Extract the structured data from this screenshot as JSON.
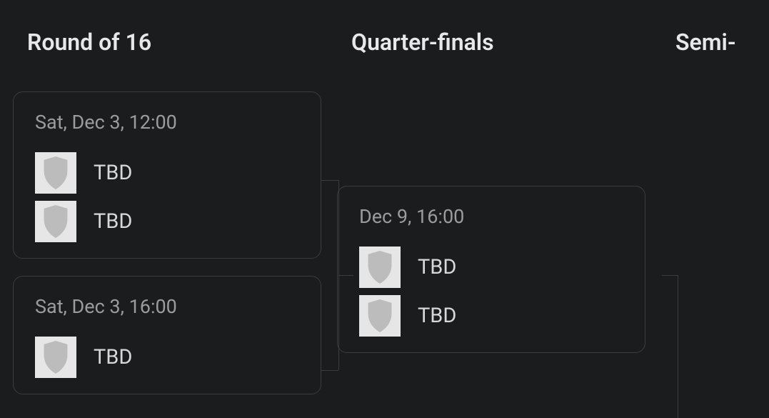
{
  "rounds": {
    "r16": {
      "title": "Round of 16"
    },
    "qf": {
      "title": "Quarter-finals"
    },
    "sf": {
      "title": "Semi-"
    }
  },
  "matches": {
    "r16_1": {
      "date": "Sat, Dec 3, 12:00",
      "team1": "TBD",
      "team2": "TBD"
    },
    "r16_2": {
      "date": "Sat, Dec 3, 16:00",
      "team1": "TBD"
    },
    "qf_1": {
      "date": "Dec 9, 16:00",
      "team1": "TBD",
      "team2": "TBD"
    }
  }
}
